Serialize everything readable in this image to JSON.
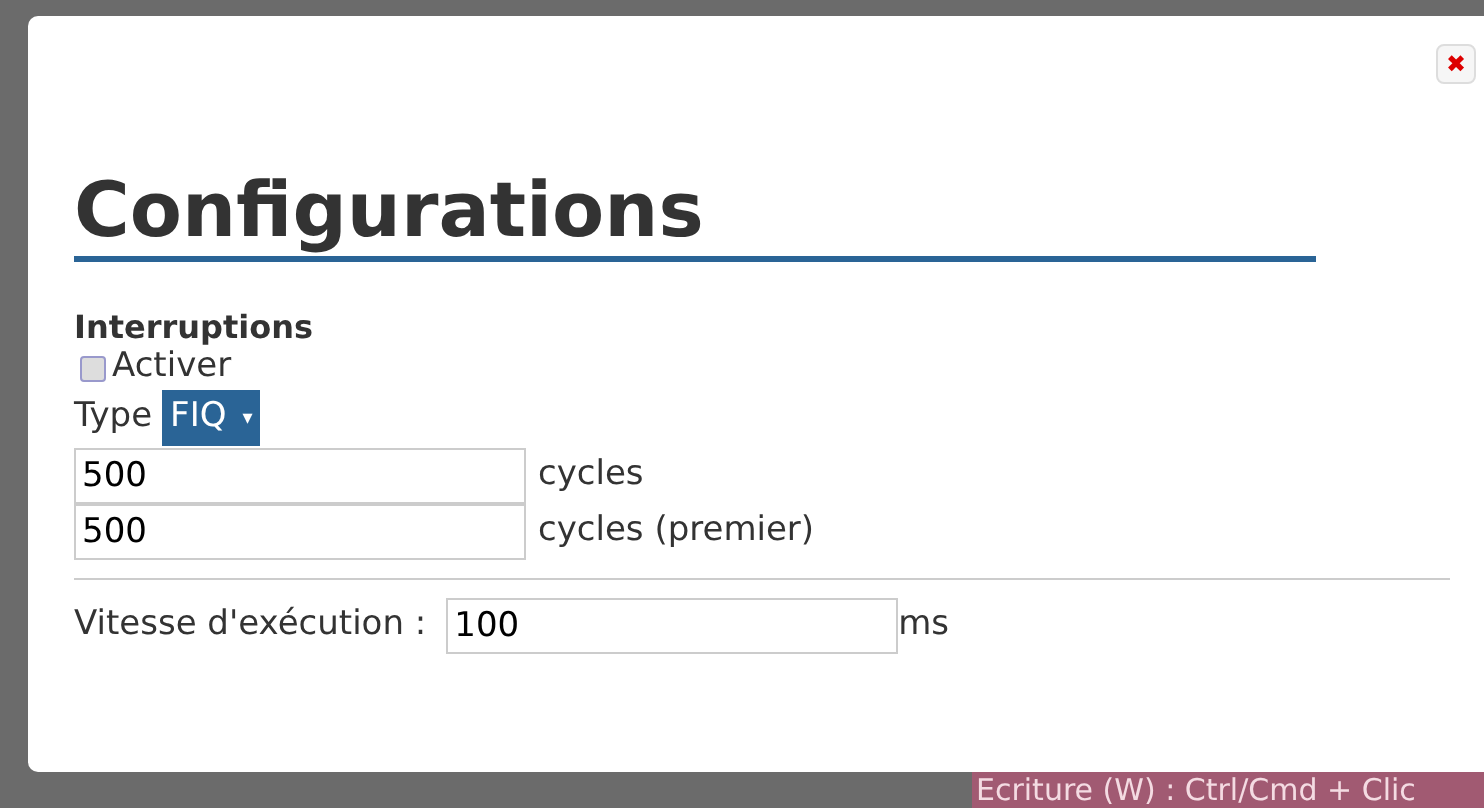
{
  "background": {
    "status_text": "Ecriture (W) : Ctrl/Cmd + Clic"
  },
  "dialog": {
    "close": "✖",
    "title": "Configurations",
    "section": "Interruptions",
    "enable": {
      "label": "Activer",
      "checked": false
    },
    "type": {
      "label": "Type",
      "value": "FIQ",
      "caret": "▾"
    },
    "cycle_fields": [
      {
        "value": "500",
        "unit": "cycles"
      },
      {
        "value": "500",
        "unit": "cycles (premier)"
      }
    ],
    "speed": {
      "label": "Vitesse d'exécution :",
      "value": "100",
      "unit": "ms"
    }
  }
}
